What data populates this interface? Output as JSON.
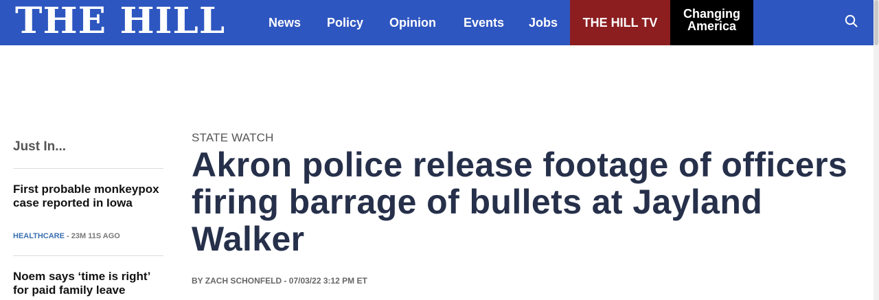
{
  "header": {
    "logo": "THE HILL",
    "nav": [
      "News",
      "Policy",
      "Opinion",
      "Events",
      "Jobs"
    ],
    "hill_tv": "THE HILL TV",
    "changing_line1": "Changing",
    "changing_line2": "America",
    "colors": {
      "bar": "#2e56c0",
      "hill_tv": "#8c1e20",
      "changing": "#000000"
    }
  },
  "sidebar": {
    "title": "Just In...",
    "items": [
      {
        "headline": "First probable monkeypox case reported in Iowa",
        "category": "HEALTHCARE",
        "age": " - 23M 11S AGO"
      },
      {
        "headline": "Noem says ‘time is right’ for paid family leave"
      }
    ]
  },
  "article": {
    "kicker": "STATE WATCH",
    "title": "Akron police release footage of officers firing barrage of bullets at Jayland Walker",
    "byline": "BY ZACH SCHONFELD - 07/03/22 3:12 PM ET"
  }
}
